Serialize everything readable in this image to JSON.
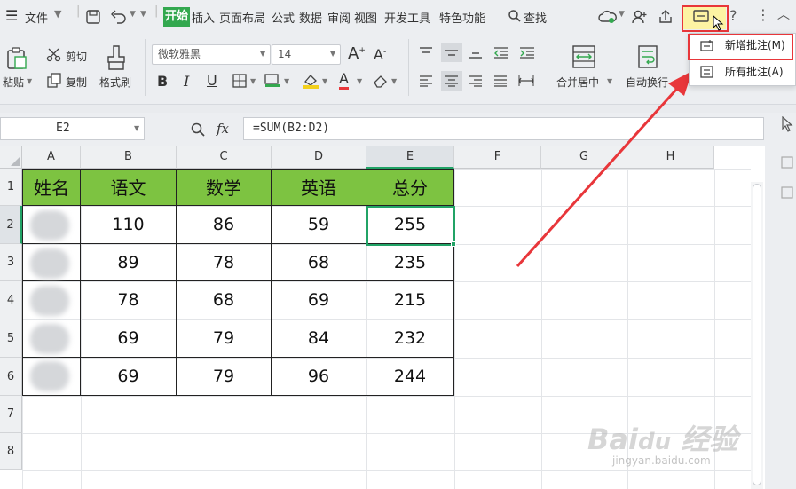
{
  "menubar": {
    "file": "文件",
    "tabs": [
      "开始",
      "插入",
      "页面布局",
      "公式",
      "数据",
      "审阅",
      "视图",
      "开发工具",
      "特色功能"
    ],
    "search": "查找"
  },
  "ribbon": {
    "paste": "粘贴",
    "cut": "剪切",
    "copy": "复制",
    "format_painter": "格式刷",
    "font_name": "微软雅黑",
    "font_size": "14",
    "merge_center": "合并居中",
    "auto_wrap": "自动换行"
  },
  "formula_bar": {
    "cell_ref": "E2",
    "fx": "fx",
    "formula": "=SUM(B2:D2)"
  },
  "columns": [
    "A",
    "B",
    "C",
    "D",
    "E",
    "F",
    "G",
    "H"
  ],
  "rows": [
    "1",
    "2",
    "3",
    "4",
    "5",
    "6",
    "7",
    "8"
  ],
  "table": {
    "headers": [
      "姓名",
      "语文",
      "数学",
      "英语",
      "总分"
    ],
    "rows": [
      [
        "",
        "110",
        "86",
        "59",
        "255"
      ],
      [
        "",
        "89",
        "78",
        "68",
        "235"
      ],
      [
        "",
        "78",
        "68",
        "69",
        "215"
      ],
      [
        "",
        "69",
        "79",
        "84",
        "232"
      ],
      [
        "",
        "69",
        "79",
        "96",
        "244"
      ]
    ]
  },
  "comment_menu": {
    "new_comment": "新增批注(M)",
    "all_comments": "所有批注(A)"
  },
  "colors": {
    "header_fill": "#7dc341",
    "active_tab": "#33a84f",
    "highlight": "#e8363a",
    "selection": "#21a366"
  }
}
